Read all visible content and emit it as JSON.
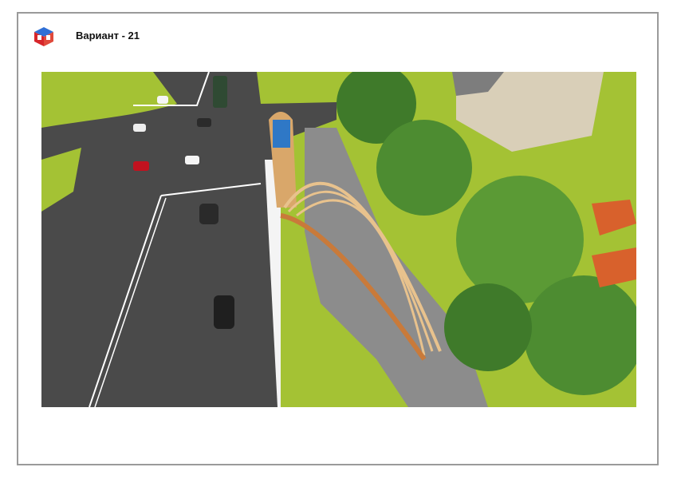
{
  "header": {
    "title": "Вариант - 21",
    "logo_icon": "cube-logo-icon"
  },
  "render": {
    "icon": "aerial-render-image"
  }
}
